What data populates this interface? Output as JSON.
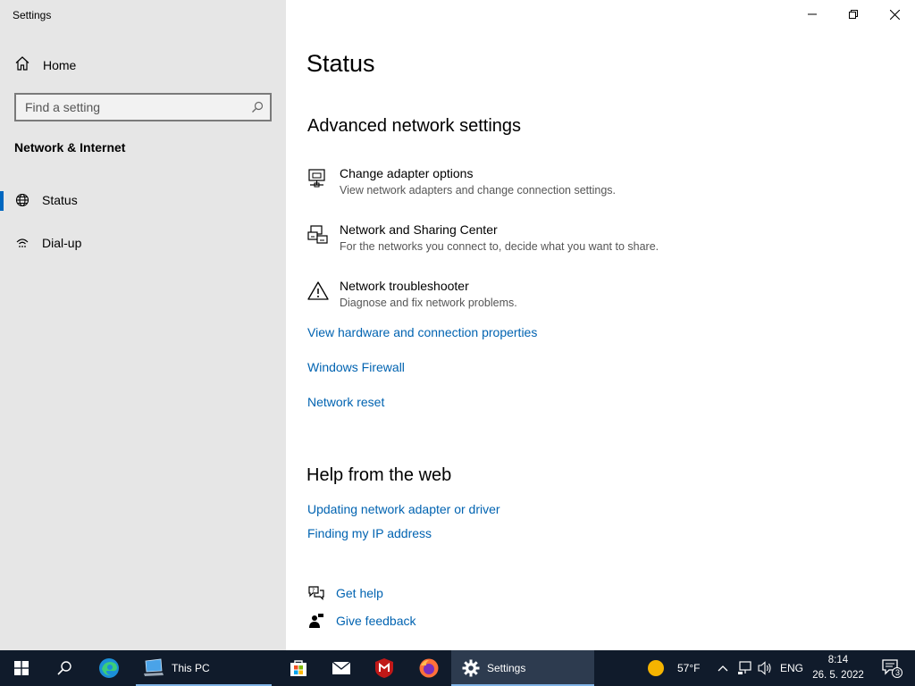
{
  "window": {
    "title": "Settings"
  },
  "sidebar": {
    "home_label": "Home",
    "search_placeholder": "Find a setting",
    "section_title": "Network & Internet",
    "items": [
      {
        "label": "Status",
        "icon": "globe-icon"
      },
      {
        "label": "Dial-up",
        "icon": "dialup-icon"
      }
    ]
  },
  "main": {
    "page_title": "Status",
    "advanced": {
      "heading": "Advanced network settings",
      "items": [
        {
          "title": "Change adapter options",
          "desc": "View network adapters and change connection settings.",
          "icon": "adapter-icon"
        },
        {
          "title": "Network and Sharing Center",
          "desc": "For the networks you connect to, decide what you want to share.",
          "icon": "sharing-center-icon"
        },
        {
          "title": "Network troubleshooter",
          "desc": "Diagnose and fix network problems.",
          "icon": "warning-icon"
        }
      ],
      "links": [
        "View hardware and connection properties",
        "Windows Firewall",
        "Network reset"
      ]
    },
    "help": {
      "heading": "Help from the web",
      "links": [
        "Updating network adapter or driver",
        "Finding my IP address"
      ]
    },
    "support": {
      "get_help": "Get help",
      "give_feedback": "Give feedback"
    }
  },
  "taskbar": {
    "this_pc_label": "This PC",
    "settings_label": "Settings",
    "weather": "57°F",
    "language": "ENG",
    "time": "8:14",
    "date": "26. 5. 2022",
    "notification_count": "3"
  },
  "colors": {
    "accent": "#0067c0",
    "link": "#0063b1",
    "sidebar_bg": "#e6e6e6",
    "taskbar_bg": "#101b2b"
  }
}
